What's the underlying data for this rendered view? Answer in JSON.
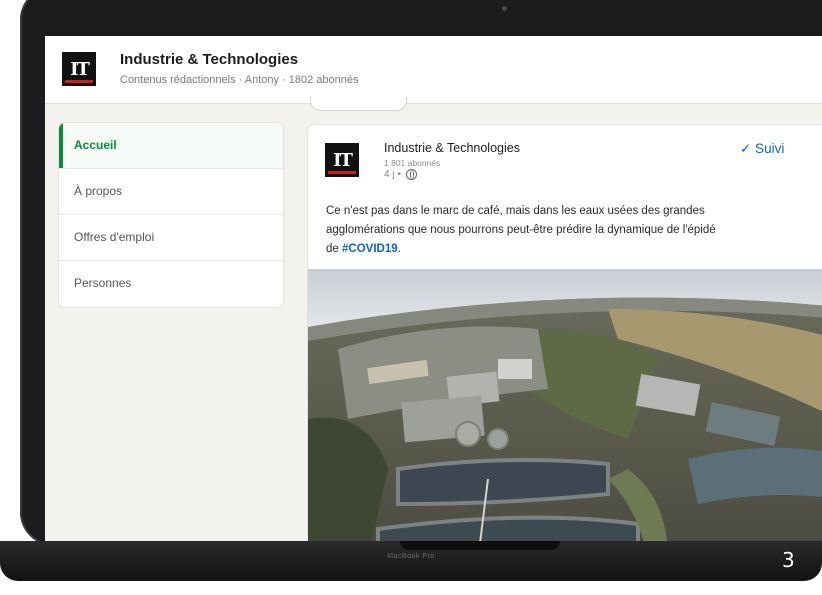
{
  "company": {
    "logo_text": "IT",
    "name": "Industrie & Technologies",
    "subtitle": "Contenus rédactionnels · Antony · 1802 abonnés"
  },
  "sidebar": {
    "items": [
      {
        "label": "Accueil",
        "active": true
      },
      {
        "label": "À propos",
        "active": false
      },
      {
        "label": "Offres d'emploi",
        "active": false
      },
      {
        "label": "Personnes",
        "active": false
      }
    ]
  },
  "post": {
    "author": "Industrie & Technologies",
    "followers": "1 801 abonnés",
    "time": "4 j •",
    "follow_label": "✓ Suivi",
    "text_line1": "Ce n'est pas dans le marc de café, mais dans les eaux usées des grandes",
    "text_line2": "agglomérations que nous pourrons peut-être prédire la dynamique de l'épidé",
    "text_line3_prefix": "de ",
    "hashtag": "#COVID19",
    "text_line3_suffix": "."
  },
  "device": {
    "label": "MacBook Pro"
  },
  "page_number": "3",
  "colors": {
    "accent_green": "#0a8a3c",
    "link_blue": "#0a66c2",
    "logo_red": "#c8201c"
  }
}
